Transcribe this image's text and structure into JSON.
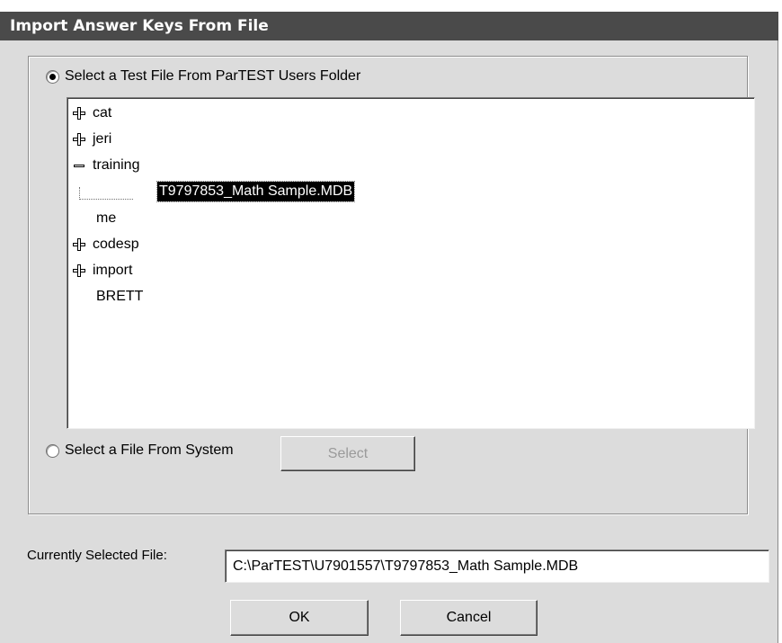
{
  "window": {
    "title": "Import Answer Keys From File"
  },
  "options": {
    "users_folder_label": "Select a Test File From ParTEST Users Folder",
    "system_label": "Select a File From System",
    "select_button": "Select",
    "selected_option": "users_folder"
  },
  "tree": {
    "nodes": [
      {
        "label": "cat",
        "expander": "plus"
      },
      {
        "label": "jeri",
        "expander": "plus"
      },
      {
        "label": "training",
        "expander": "minus"
      },
      {
        "label": "T9797853_Math Sample.MDB",
        "expander": "none",
        "selected": true
      },
      {
        "label": "me",
        "expander": "none"
      },
      {
        "label": "codesp",
        "expander": "plus"
      },
      {
        "label": "import",
        "expander": "plus"
      },
      {
        "label": "BRETT",
        "expander": "none"
      }
    ]
  },
  "current_file": {
    "label": "Currently Selected File:",
    "value": "C:\\ParTEST\\U7901557\\T9797853_Math Sample.MDB"
  },
  "buttons": {
    "ok": "OK",
    "cancel": "Cancel"
  }
}
